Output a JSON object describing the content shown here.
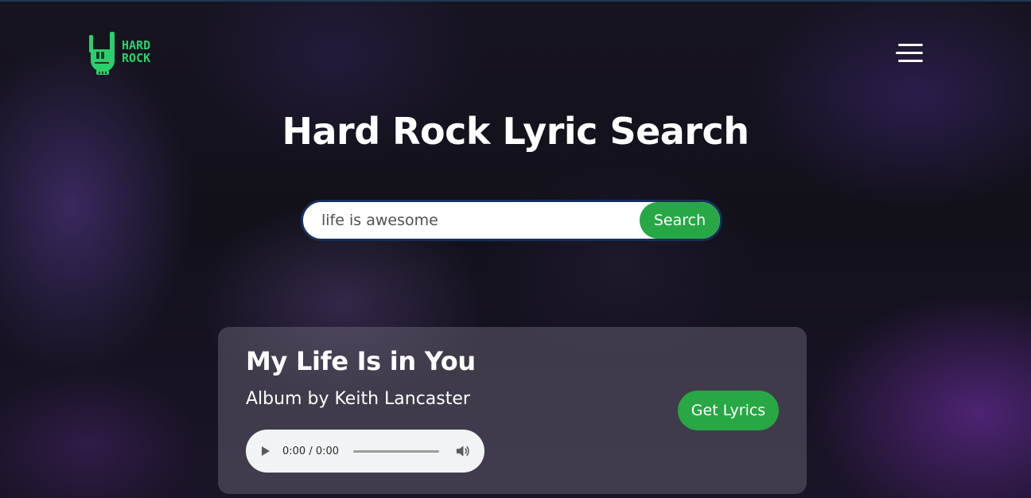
{
  "header": {
    "logo": {
      "line1": "HARD",
      "line2": "ROCK",
      "icon": "rock-hand-icon",
      "color": "#2ad06c"
    },
    "menu_icon": "hamburger-menu-icon"
  },
  "main": {
    "title": "Hard Rock Lyric Search",
    "search": {
      "value": "life is awesome",
      "button_label": "Search"
    }
  },
  "result": {
    "title": "My Life Is in You",
    "artist": "Album by Keith Lancaster",
    "audio": {
      "time": "0:00 / 0:00",
      "play_icon": "play-icon",
      "volume_icon": "volume-icon"
    },
    "lyrics_button_label": "Get Lyrics"
  },
  "colors": {
    "accent": "#28a745",
    "search_border": "#17305a",
    "card_bg": "rgba(120,115,130,0.42)"
  }
}
